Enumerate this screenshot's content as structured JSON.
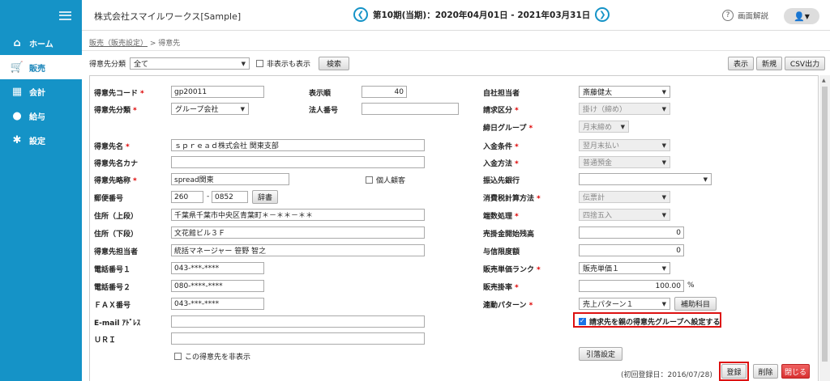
{
  "nav": [
    {
      "label": "ホーム",
      "icon": "home-icon",
      "glyph": "⌂"
    },
    {
      "label": "販売",
      "icon": "cart-icon",
      "glyph": "🛒",
      "active": true
    },
    {
      "label": "会計",
      "icon": "calculator-icon",
      "glyph": "▦"
    },
    {
      "label": "給与",
      "icon": "money-bag-icon",
      "glyph": "●"
    },
    {
      "label": "設定",
      "icon": "gear-icon",
      "glyph": "✱"
    }
  ],
  "header": {
    "company": "株式会社スマイルワークス[Sample]",
    "period": "第10期(当期)：2020年04月01日 - 2021年03月31日",
    "help": "画面解説"
  },
  "breadcrumb": {
    "parent": "販売（販売設定）",
    "sep": " > ",
    "current": "得意先"
  },
  "filter": {
    "label": "得意先分類",
    "value": "全て",
    "show_hidden": "非表示も表示",
    "search": "検索"
  },
  "toolbar": {
    "display": "表示",
    "new": "新規",
    "csv": "CSV出力"
  },
  "left": {
    "code_label": "得意先コード",
    "code": "gp20011",
    "class_label": "得意先分類",
    "class": "グループ会社",
    "order_label": "表示順",
    "order": "40",
    "corp_label": "法人番号",
    "corp": "",
    "name_label": "得意先名",
    "name": "ｓｐｒｅａｄ株式会社 関東支部",
    "kana_label": "得意先名カナ",
    "kana": "",
    "short_label": "得意先略称",
    "short": "spread関東",
    "personal": "個人顧客",
    "zip_label": "郵便番号",
    "zip1": "260",
    "zip2": "0852",
    "dict": "辞書",
    "addr1_label": "住所（上段）",
    "addr1": "千葉県千葉市中央区青葉町＊－＊＊－＊＊",
    "addr2_label": "住所（下段）",
    "addr2": "文花館ビル３Ｆ",
    "contact_label": "得意先担当者",
    "contact": "統括マネージャー 笹野 智之",
    "tel1_label": "電話番号１",
    "tel1": "043-***-****",
    "tel2_label": "電話番号２",
    "tel2": "080-****-****",
    "fax_label": "ＦＡＸ番号",
    "fax": "043-***-****",
    "email_label": "E-mail ｱﾄﾞﾚｽ",
    "email": "",
    "uri_label": "ＵＲＩ",
    "uri": "",
    "hide": "この得意先を非表示"
  },
  "right": {
    "staff_label": "自社担当者",
    "staff": "斎藤健太",
    "bill_label": "請求区分",
    "bill": "掛け（締め）",
    "close_label": "締日グループ",
    "close": "月末締め",
    "cond_label": "入金条件",
    "cond": "翌月末払い",
    "method_label": "入金方法",
    "method": "普通預金",
    "bank_label": "振込先銀行",
    "bank": "",
    "tax_label": "消費税計算方法",
    "tax": "伝票計",
    "round_label": "端数処理",
    "round": "四捨五入",
    "ar_label": "売掛金開始残高",
    "ar": "0",
    "credit_label": "与信限度額",
    "credit": "0",
    "rank_label": "販売単価ランク",
    "rank": "販売単価１",
    "rate_label": "販売掛率",
    "rate": "100.00",
    "pct": "%",
    "pattern_label": "連動パターン",
    "pattern": "売上パターン１",
    "subject": "補助科目",
    "group_bill": "請求先を親の得意先グループへ設定する",
    "withdraw": "引落設定"
  },
  "footer": {
    "created": "(初回登録日：2016/07/28)",
    "save": "登録",
    "delete": "削除",
    "close": "閉じる"
  }
}
